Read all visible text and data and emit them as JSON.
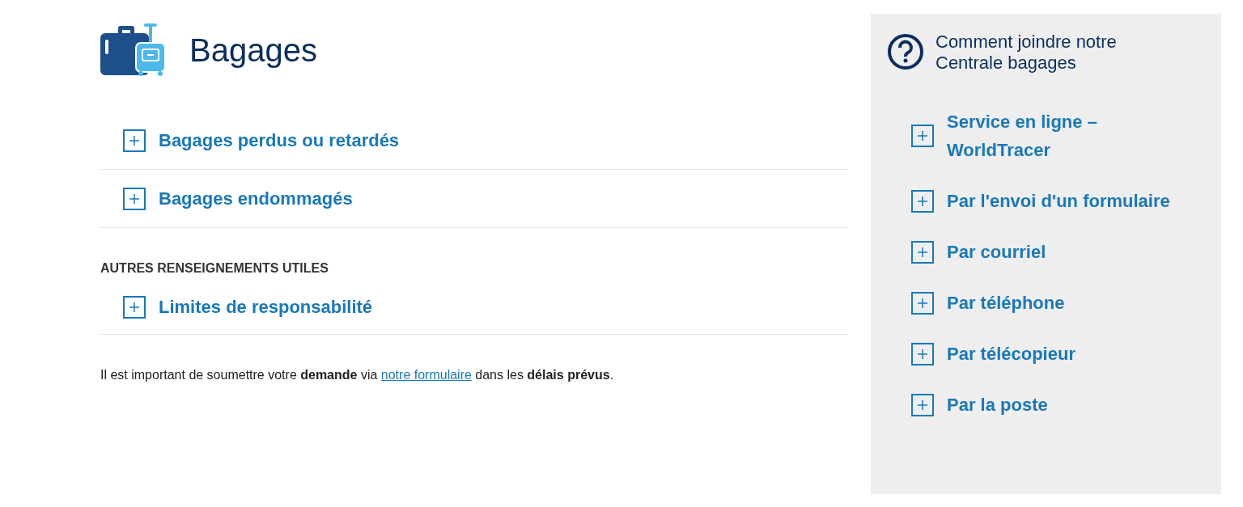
{
  "page_title": "Bagages",
  "accordion": [
    {
      "label": "Bagages perdus ou retardés",
      "expanded": false
    },
    {
      "label": "Bagages endommagés",
      "expanded": false
    }
  ],
  "section": {
    "heading": "AUTRES RENSEIGNEMENTS UTILES",
    "accordion": [
      {
        "label": "Limites de responsabilité",
        "expanded": false
      }
    ]
  },
  "note": {
    "before": "Il est important de soumettre votre **demande** via ",
    "link": "notre formulaire",
    "after": " dans les **délais prévus**."
  },
  "sidebar": {
    "heading": "Comment joindre notre Centrale bagages",
    "items": [
      {
        "label": "Service en ligne – WorldTracer",
        "expanded": false
      },
      {
        "label": "Par l'envoi d'un formulaire",
        "expanded": false
      },
      {
        "label": "Par courriel",
        "expanded": false
      },
      {
        "label": "Par téléphone",
        "expanded": false
      },
      {
        "label": "Par télécopieur",
        "expanded": false
      },
      {
        "label": "Par la poste",
        "expanded": false
      }
    ]
  }
}
